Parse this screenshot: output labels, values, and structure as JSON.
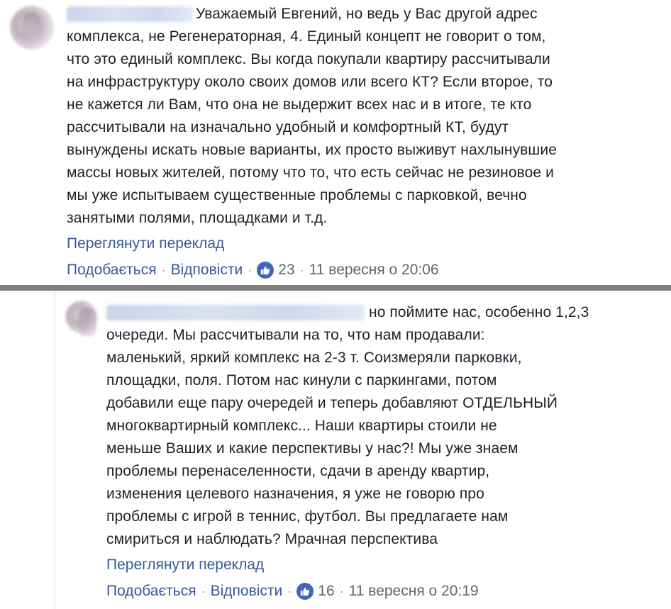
{
  "comment1": {
    "author_blurred": "Irina Alyabyeva",
    "text": "Уважаемый Евгений, но ведь у Вас другой адрес\nкомплекса, не Регенераторная, 4. Единый концепт не говорит о том,\nчто это единый комплекс. Вы когда покупали квартиру рассчитывали\nна инфраструктуру около своих домов или всего КТ? Если второе, то\nне кажется ли Вам, что она не выдержит всех нас и в итоге, те кто\nрассчитывали на изначально удобный и комфортный КТ, будут\nвынуждены искать новые варианты, их просто выживут нахлынувшие\nмассы новых жителей, потому что то, что есть сейчас не резиновое и\nмы уже испытываем существенные проблемы с парковкой, вечно\nзанятыми полями, площадками и т.д.",
    "see_translation": "Переглянути переклад",
    "like_label": "Подобається",
    "reply_label": "Відповісти",
    "like_count": "23",
    "timestamp": "11 вересня о 20:06"
  },
  "comment2": {
    "author_blurred": "Irina Alyabyeva Евгений Курец",
    "text": "очереди. Мы рассчитывали на то, что нам продавали:\nмаленький, яркий комплекс на 2-3 т. Соизмеряли парковки,\nплощадки, поля. Потом нас кинули с паркингами, потом\nдобавили еще пару очередей и теперь добавляют ОТДЕЛЬНЫЙ\nмногоквартирный комплекс... Наши квартиры стоили не\nменьше Ваших и какие перспективы у нас?! Мы уже знаем\nпроблемы перенаселенности, сдачи в аренду квартир,\nизменения целевого назначения, я уже не говорю про\nпроблемы с игрой в теннис, футбол. Вы предлагаете нам\nсмириться и наблюдать? Мрачная перспектива",
    "first_line_tail": "но поймите нас, особенно 1,2,3",
    "see_translation": "Переглянути переклад",
    "like_label": "Подобається",
    "reply_label": "Відповісти",
    "like_count": "16",
    "timestamp": "11 вересня о 20:19"
  },
  "colors": {
    "link": "#385898",
    "text": "#1d2129",
    "meta": "#616770",
    "like_badge": "#4267b2",
    "divider": "#7f7f7f"
  }
}
